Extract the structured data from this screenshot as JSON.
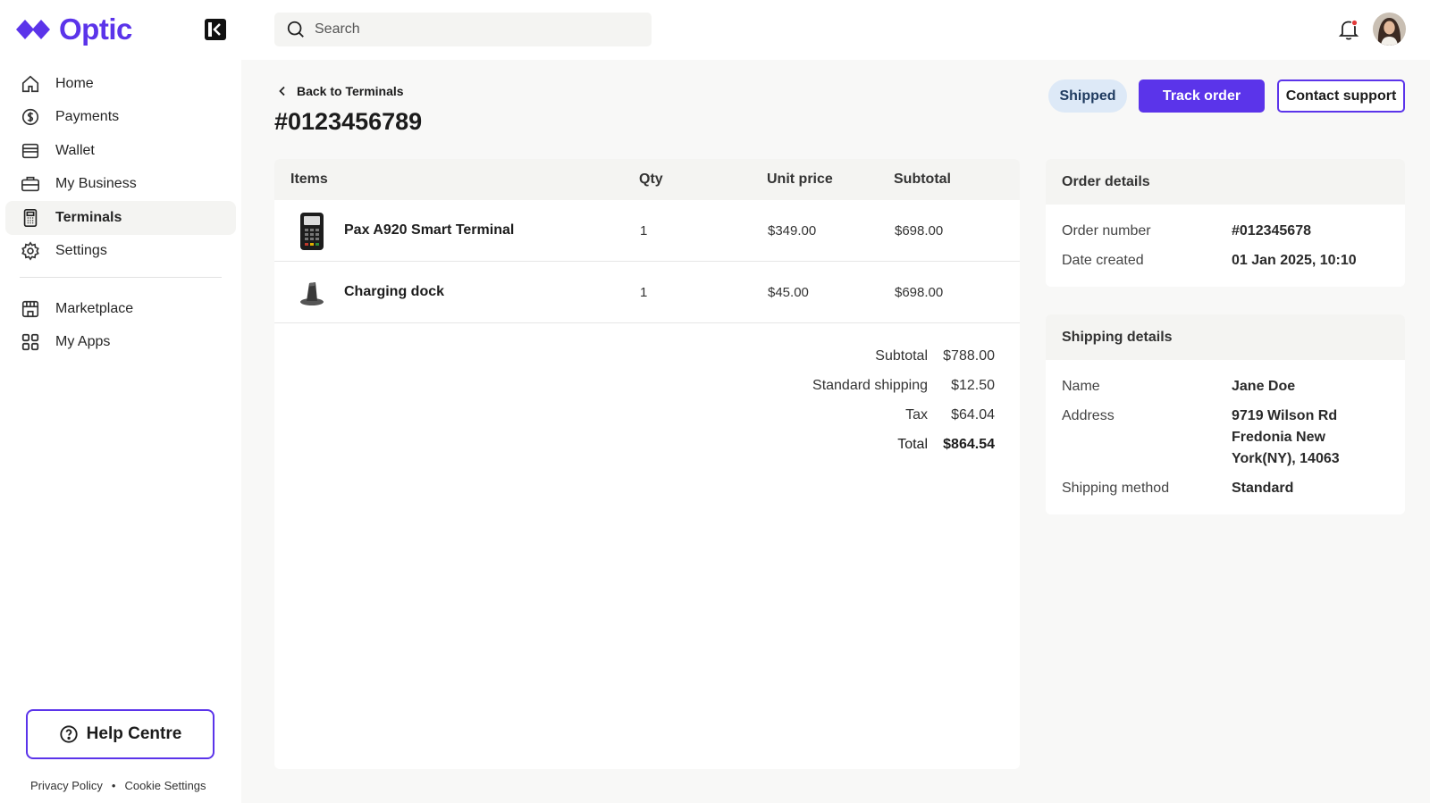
{
  "brand": {
    "name": "Optic",
    "color": "#5b34ea"
  },
  "sidebar": {
    "items": [
      {
        "label": "Home",
        "icon": "home-icon",
        "active": false
      },
      {
        "label": "Payments",
        "icon": "dollar-icon",
        "active": false
      },
      {
        "label": "Wallet",
        "icon": "wallet-icon",
        "active": false
      },
      {
        "label": "My Business",
        "icon": "briefcase-icon",
        "active": false
      },
      {
        "label": "Terminals",
        "icon": "terminal-icon",
        "active": true
      },
      {
        "label": "Settings",
        "icon": "gear-icon",
        "active": false
      }
    ],
    "secondary_items": [
      {
        "label": "Marketplace",
        "icon": "store-icon"
      },
      {
        "label": "My Apps",
        "icon": "apps-grid-icon"
      }
    ],
    "help_label": "Help Centre",
    "footer": {
      "privacy": "Privacy Policy",
      "separator": "•",
      "cookies": "Cookie Settings"
    }
  },
  "topbar": {
    "search_placeholder": "Search"
  },
  "page": {
    "back_label": "Back to Terminals",
    "title": "#0123456789",
    "status": "Shipped",
    "track_label": "Track order",
    "contact_label": "Contact support"
  },
  "items_table": {
    "columns": [
      "Items",
      "Qty",
      "Unit price",
      "Subtotal"
    ],
    "rows": [
      {
        "name": "Pax A920 Smart Terminal",
        "qty": "1",
        "unit_price": "$349.00",
        "subtotal": "$698.00"
      },
      {
        "name": "Charging dock",
        "qty": "1",
        "unit_price": "$45.00",
        "subtotal": "$698.00"
      }
    ]
  },
  "totals": [
    {
      "label": "Subtotal",
      "value": "$788.00"
    },
    {
      "label": "Standard shipping",
      "value": "$12.50"
    },
    {
      "label": "Tax",
      "value": "$64.04"
    },
    {
      "label": "Total",
      "value": "$864.54"
    }
  ],
  "order_details": {
    "title": "Order details",
    "rows": [
      {
        "label": "Order number",
        "value": "#012345678"
      },
      {
        "label": "Date created",
        "value": "01 Jan 2025, 10:10"
      }
    ]
  },
  "shipping_details": {
    "title": "Shipping details",
    "rows": [
      {
        "label": "Name",
        "value": "Jane Doe"
      },
      {
        "label": "Address",
        "value": "9719 Wilson Rd Fredonia New York(NY), 14063"
      },
      {
        "label": "Shipping method",
        "value": "Standard"
      }
    ]
  }
}
